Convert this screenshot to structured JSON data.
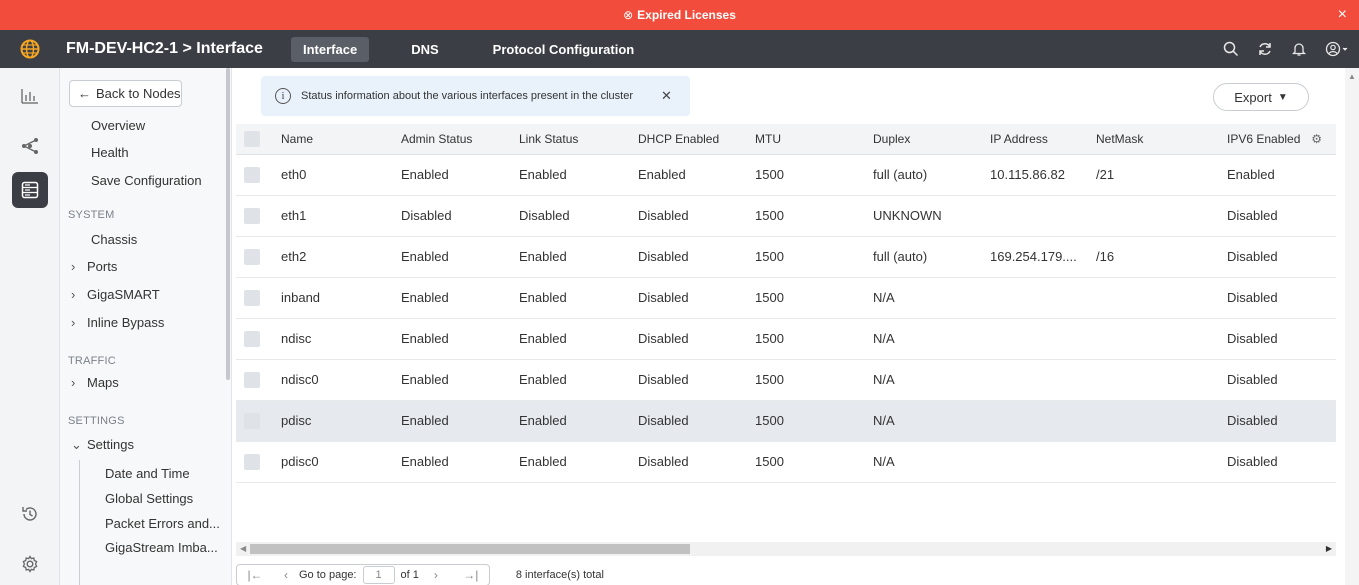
{
  "banner": {
    "text": "Expired Licenses",
    "close": "×"
  },
  "topnav": {
    "breadcrumb": "FM-DEV-HC2-1 > Interface",
    "tabs": [
      "Interface",
      "DNS",
      "Protocol Configuration"
    ],
    "active_tab": "Interface"
  },
  "sidebar": {
    "back_label": "Back to Nodes",
    "top_items": [
      "Overview",
      "Health",
      "Save Configuration"
    ],
    "sections": {
      "system": "SYSTEM",
      "traffic": "TRAFFIC",
      "settings": "SETTINGS"
    },
    "system_items": [
      "Chassis",
      "Ports",
      "GigaSMART",
      "Inline Bypass"
    ],
    "traffic_items": [
      "Maps"
    ],
    "settings_group": "Settings",
    "settings_items": [
      "Date and Time",
      "Global Settings",
      "Packet Errors and...",
      "GigaStream Imba..."
    ]
  },
  "info": {
    "text": "Status information about the various interfaces present in the cluster"
  },
  "export_label": "Export",
  "table": {
    "columns": [
      "Name",
      "Admin Status",
      "Link Status",
      "DHCP Enabled",
      "MTU",
      "Duplex",
      "IP Address",
      "NetMask",
      "IPV6 Enabled"
    ],
    "rows": [
      [
        "eth0",
        "Enabled",
        "Enabled",
        "Enabled",
        "1500",
        "full (auto)",
        "10.115.86.82",
        "/21",
        "Enabled"
      ],
      [
        "eth1",
        "Disabled",
        "Disabled",
        "Disabled",
        "1500",
        "UNKNOWN",
        "",
        "",
        "Disabled"
      ],
      [
        "eth2",
        "Enabled",
        "Enabled",
        "Disabled",
        "1500",
        "full (auto)",
        "169.254.179....",
        "/16",
        "Disabled"
      ],
      [
        "inband",
        "Enabled",
        "Enabled",
        "Disabled",
        "1500",
        "N/A",
        "",
        "",
        "Disabled"
      ],
      [
        "ndisc",
        "Enabled",
        "Enabled",
        "Disabled",
        "1500",
        "N/A",
        "",
        "",
        "Disabled"
      ],
      [
        "ndisc0",
        "Enabled",
        "Enabled",
        "Disabled",
        "1500",
        "N/A",
        "",
        "",
        "Disabled"
      ],
      [
        "pdisc",
        "Enabled",
        "Enabled",
        "Disabled",
        "1500",
        "N/A",
        "",
        "",
        "Disabled"
      ],
      [
        "pdisc0",
        "Enabled",
        "Enabled",
        "Disabled",
        "1500",
        "N/A",
        "",
        "",
        "Disabled"
      ]
    ],
    "highlighted_row": 6
  },
  "pager": {
    "go_to_label": "Go to page:",
    "page": "1",
    "of_label": "of 1",
    "total": "8 interface(s) total"
  },
  "colors": {
    "banner": "#f24d3c",
    "topnav": "#3b3e45",
    "logo": "#f6a623",
    "info_bg": "#e9f1fb"
  }
}
